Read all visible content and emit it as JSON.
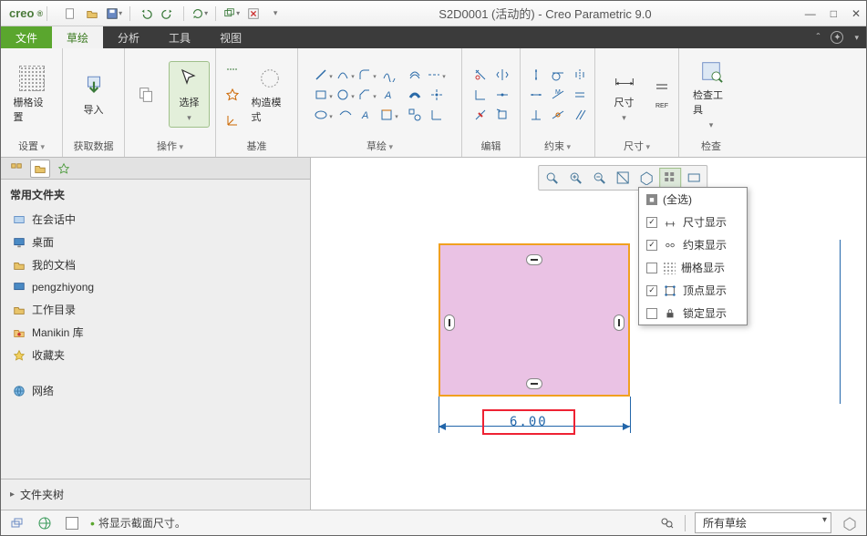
{
  "app": {
    "brand": "creo",
    "title": "S2D0001 (活动的) - Creo Parametric 9.0"
  },
  "tabs": {
    "file": "文件",
    "sketch": "草绘",
    "analysis": "分析",
    "tools": "工具",
    "view": "视图"
  },
  "ribbon": {
    "grid": {
      "big": "栅格设置",
      "label": "设置"
    },
    "import": {
      "big": "导入",
      "label": "获取数据"
    },
    "select": {
      "big": "选择",
      "label": "操作"
    },
    "construct": {
      "big": "构造模式",
      "label": "基准"
    },
    "sketch_label": "草绘",
    "edit_label": "编辑",
    "constraint_label": "约束",
    "dim": {
      "big": "尺寸",
      "label": "尺寸"
    },
    "check": {
      "big": "检查工具",
      "label": "检查"
    }
  },
  "sidebar": {
    "header": "常用文件夹",
    "items": [
      {
        "label": "在会话中",
        "icon": "session"
      },
      {
        "label": "桌面",
        "icon": "desktop"
      },
      {
        "label": "我的文档",
        "icon": "docs"
      },
      {
        "label": "pengzhiyong",
        "icon": "volume"
      },
      {
        "label": "工作目录",
        "icon": "workdir"
      },
      {
        "label": "Manikin 库",
        "icon": "manikin"
      },
      {
        "label": "收藏夹",
        "icon": "fav"
      },
      {
        "label": "网络",
        "icon": "network"
      }
    ],
    "tree_label": "文件夹树"
  },
  "display_menu": {
    "items": [
      {
        "label": "(全选)",
        "checked": true,
        "tristate": true
      },
      {
        "label": "尺寸显示",
        "checked": true
      },
      {
        "label": "约束显示",
        "checked": true
      },
      {
        "label": "栅格显示",
        "checked": false
      },
      {
        "label": "顶点显示",
        "checked": true
      },
      {
        "label": "锁定显示",
        "checked": false
      }
    ]
  },
  "sketch": {
    "dim_value": "6.00"
  },
  "status": {
    "message": "将显示截面尺寸。",
    "filter": "所有草绘"
  }
}
